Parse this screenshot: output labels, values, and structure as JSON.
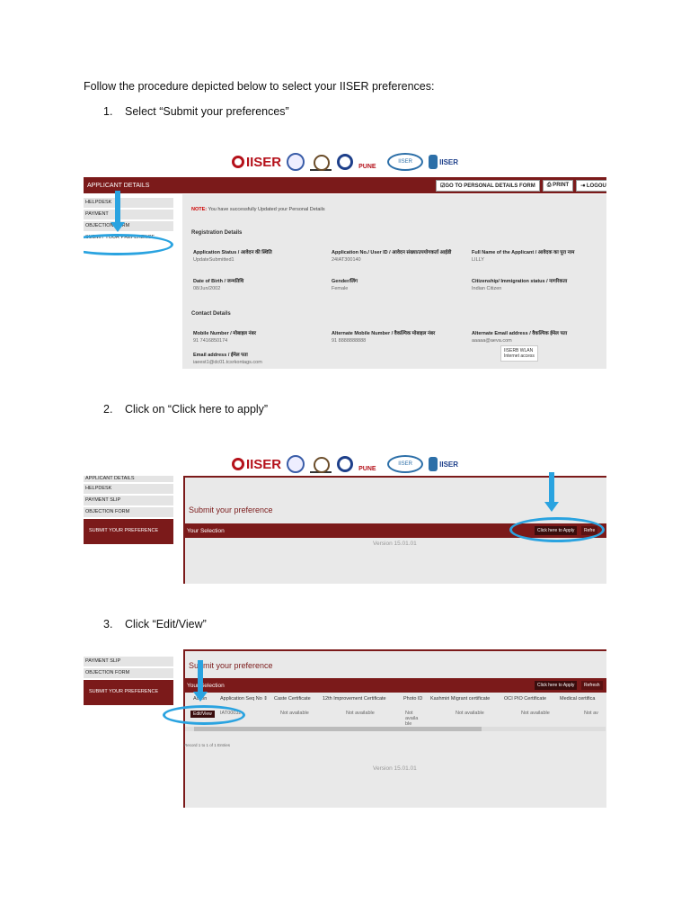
{
  "intro": "Follow the procedure depicted below to select your IISER preferences:",
  "steps": [
    {
      "num": "1.",
      "text": "Select “Submit your preferences”"
    },
    {
      "num": "2.",
      "text": "Click on “Click here to apply”"
    },
    {
      "num": "3.",
      "text": "Click “Edit/View”"
    }
  ],
  "colors": {
    "brand": "#7b1a1a",
    "highlight": "#2aa3e0"
  },
  "logo_text": "IISER",
  "header_buttons": {
    "personal": "☑GO TO PERSONAL DETAILS FORM",
    "print": "⎙ PRINT",
    "logout": "⇥ LOGOUT"
  },
  "shot1": {
    "applicant_details": "APPLICANT DETAILS",
    "sidebar": [
      "HELPDESK",
      "PAYMENT",
      "OBJECTION FORM",
      "SUBMIT YOUR PREFERENCE"
    ],
    "note_label": "NOTE:",
    "note_text": "You have successfully Updated your Personal Details",
    "registration_heading": "Registration Details",
    "fields": [
      {
        "label": "Application Status / आवेदन की स्थिति",
        "value": "UpdateSubmitted1"
      },
      {
        "label": "Application No./ User ID / आवेदन संख्या/उपयोगकर्ता आईडी",
        "value": "24IAT300140"
      },
      {
        "label": "Full Name of the Applicant / आवेदक का पूरा नाम",
        "value": "LILLY"
      },
      {
        "label": "Date of Birth / जन्मतिथि",
        "value": "08/Jun/2002"
      },
      {
        "label": "Gender/लिंग",
        "value": "Female"
      },
      {
        "label": "Citizenship/ Immigration status / नागरिकता",
        "value": "Indian Citizen"
      }
    ],
    "contact_heading": "Contact Details",
    "contact": [
      {
        "label": "Mobile Number / मोबाइल नंबर",
        "value": "91 7416850174"
      },
      {
        "label": "Alternate Mobile Number / वैकल्पिक मोबाइल नंबर",
        "value": "91 8888888888"
      },
      {
        "label": "Alternate Email address / वैकल्पिक ईमेल पता",
        "value": "aaaaa@aeva.com"
      },
      {
        "label": "Email address / ईमेल पता",
        "value": "iaeest1@dc01.tcsrkontags.com"
      }
    ],
    "tooltip_line1": "IISERB WLAN",
    "tooltip_line2": "Internet access"
  },
  "shot2": {
    "sidebar": [
      "APPLICANT DETAILS",
      "HELPDESK",
      "PAYMENT SLIP",
      "OBJECTION FORM",
      "SUBMIT YOUR PREFERENCE"
    ],
    "title": "Submit your preference",
    "selection": "Your Selection",
    "apply_btn": "Click here to Apply",
    "refresh_btn": "Refre",
    "version": "Version 15.01.01"
  },
  "shot3": {
    "sidebar": [
      "PAYMENT SLIP",
      "OBJECTION FORM",
      "SUBMIT YOUR PREFERENCE"
    ],
    "title": "Submit your preference",
    "selection": "Your Selection",
    "apply_btn": "Click here to Apply",
    "refresh_btn": "Refresh",
    "columns": [
      "Action",
      "Application Seq No ⇕",
      "Caste Certificate",
      "12th Improvement Certificate",
      "Photo ID",
      "Kashmiri Migrant certificate",
      "OCI PIO Certificate",
      "Medical certifica"
    ],
    "edit_btn": "Edit/View",
    "row": [
      "IAT00032",
      "Not available",
      "Not available",
      "Not availa ble",
      "Not available",
      "Not available",
      "Not av"
    ],
    "record_count": "Record 1 to 1 of 1 Entries",
    "version": "Version 15.01.01"
  }
}
